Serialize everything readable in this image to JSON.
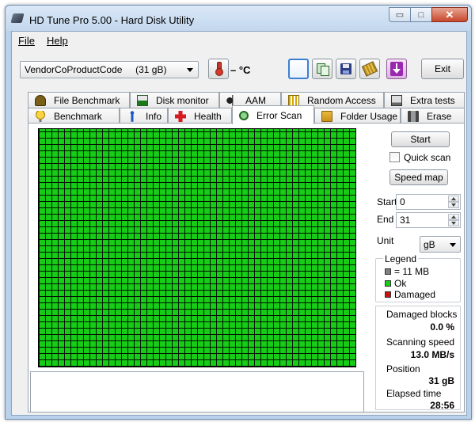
{
  "window": {
    "title": "HD Tune Pro 5.00 - Hard Disk Utility",
    "controls": {
      "minimize": "▭",
      "maximize": "□",
      "close": "✕"
    }
  },
  "menu": [
    {
      "label": "File"
    },
    {
      "label": "Help"
    }
  ],
  "toolbar": {
    "drive": "VendorCoProductCode     (31 gB)",
    "temperature": "– °C",
    "exit_label": "Exit",
    "icons": [
      "thermometer-icon",
      "blank-icon",
      "copy-icon",
      "save-icon",
      "chip-icon",
      "download-icon"
    ]
  },
  "tabs_row1": [
    {
      "label": "File Benchmark",
      "icon": "file-benchmark-icon"
    },
    {
      "label": "Disk monitor",
      "icon": "disk-monitor-icon"
    },
    {
      "label": "AAM",
      "icon": "speaker-icon"
    },
    {
      "label": "Random Access",
      "icon": "random-access-icon"
    },
    {
      "label": "Extra tests",
      "icon": "extra-tests-icon"
    }
  ],
  "tabs_row2": [
    {
      "label": "Benchmark",
      "icon": "benchmark-icon"
    },
    {
      "label": "Info",
      "icon": "info-icon"
    },
    {
      "label": "Health",
      "icon": "health-cross-icon"
    },
    {
      "label": "Error Scan",
      "icon": "magnifier-icon",
      "selected": true
    },
    {
      "label": "Folder Usage",
      "icon": "folder-icon"
    },
    {
      "label": "Erase",
      "icon": "trash-icon"
    }
  ],
  "error_scan": {
    "start_label": "Start",
    "quick_scan_label": "Quick scan",
    "quick_scan_checked": false,
    "speed_map_label": "Speed map",
    "start_field_label": "Start",
    "start_value": "0",
    "end_field_label": "End",
    "end_value": "31",
    "unit_label": "Unit",
    "unit_value": "gB",
    "legend": {
      "title": "Legend",
      "items": [
        {
          "label": "= 11 MB",
          "color": "#808080"
        },
        {
          "label": "Ok",
          "color": "#16cc16"
        },
        {
          "label": "Damaged",
          "color": "#cc1111"
        }
      ]
    },
    "stats": {
      "damaged_blocks_label": "Damaged blocks",
      "damaged_blocks_value": "0.0 %",
      "scanning_speed_label": "Scanning speed",
      "scanning_speed_value": "13.0 MB/s",
      "position_label": "Position",
      "position_value": "31 gB",
      "elapsed_label": "Elapsed time",
      "elapsed_value": "28:56"
    },
    "grid_status": "all blocks ok",
    "grid_color": "#16cc16"
  }
}
